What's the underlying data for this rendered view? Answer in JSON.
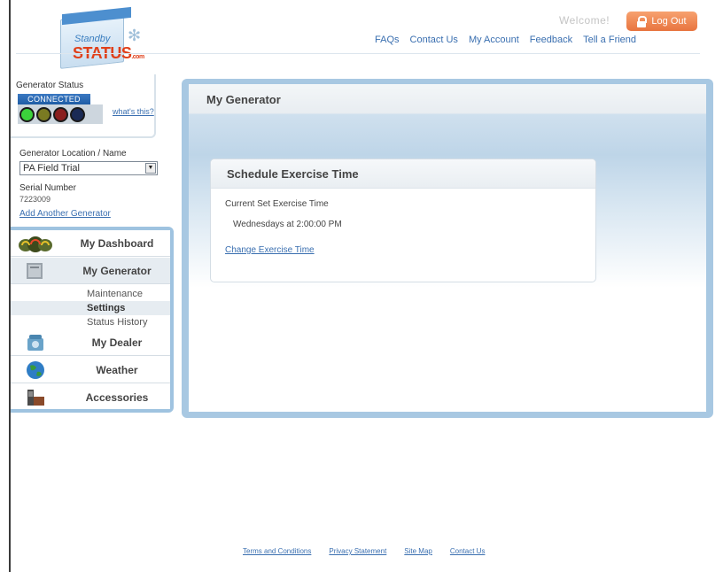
{
  "logo": {
    "line1": "Standby",
    "line2": "STATUS",
    "suffix": ".com"
  },
  "header": {
    "welcome": "Welcome!",
    "logout_label": "Log Out",
    "nav": [
      "FAQs",
      "Contact Us",
      "My Account",
      "Feedback",
      "Tell a Friend"
    ]
  },
  "generator_status": {
    "label": "Generator Status",
    "state": "CONNECTED",
    "lights": [
      "#3bd23b",
      "#7a7a22",
      "#8a1f1f",
      "#1a2a55"
    ],
    "help_link": "what's this?"
  },
  "location": {
    "label": "Generator Location / Name",
    "selected": "PA Field Trial",
    "serial_label": "Serial Number",
    "serial_value": "7223009",
    "add_link": "Add Another Generator"
  },
  "sidenav": {
    "items": [
      {
        "label": "My Dashboard",
        "icon": "gauges-icon"
      },
      {
        "label": "My Generator",
        "icon": "generator-icon"
      },
      {
        "label": "My Dealer",
        "icon": "telephone-icon"
      },
      {
        "label": "Weather",
        "icon": "globe-icon"
      },
      {
        "label": "Accessories",
        "icon": "accessories-icon"
      }
    ],
    "subitems": [
      "Maintenance",
      "Settings",
      "Status History"
    ]
  },
  "main": {
    "title": "My Generator",
    "card": {
      "title": "Schedule Exercise Time",
      "current_label": "Current Set Exercise Time",
      "current_value": "Wednesdays at 2:00:00 PM",
      "change_link": "Change Exercise Time"
    }
  },
  "footer": [
    "Terms and Conditions",
    "Privacy Statement",
    "Site Map",
    "Contact Us"
  ]
}
